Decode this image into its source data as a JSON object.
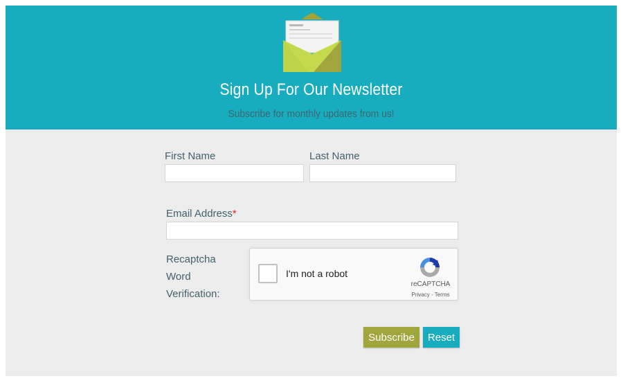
{
  "header": {
    "title": "Sign Up For Our Newsletter",
    "subtitle": "Subscribe for monthly updates from us!",
    "icon": "envelope-icon",
    "background_color": "#17adbf"
  },
  "form": {
    "first_name": {
      "label": "First Name",
      "value": "",
      "placeholder": ""
    },
    "last_name": {
      "label": "Last Name",
      "value": "",
      "placeholder": ""
    },
    "email": {
      "label": "Email Address",
      "required_marker": "*",
      "value": "",
      "placeholder": ""
    },
    "captcha": {
      "label": "Recaptcha Word Verification:",
      "checkbox_text": "I'm not a robot",
      "brand": "reCAPTCHA",
      "links": "Privacy - Terms",
      "checked": false
    },
    "buttons": {
      "subscribe": "Subscribe",
      "reset": "Reset"
    }
  },
  "colors": {
    "accent_teal": "#17adbf",
    "accent_olive": "#a0a63b",
    "required": "#e02424"
  }
}
